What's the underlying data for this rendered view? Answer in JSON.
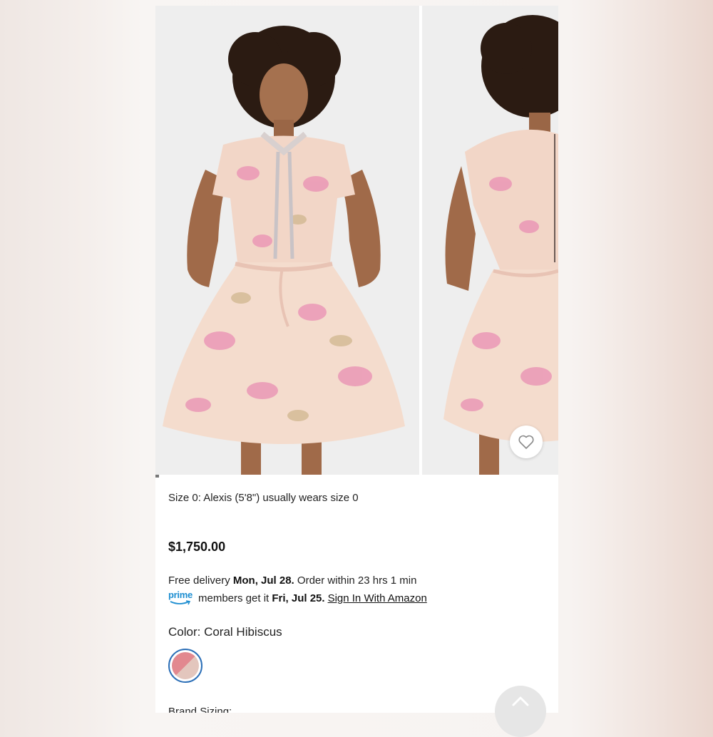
{
  "product": {
    "size_note": "Size 0: Alexis (5'8\") usually wears size 0",
    "price": "$1,750.00",
    "delivery": {
      "prefix": "Free delivery",
      "date": "Mon, Jul 28.",
      "suffix": "Order within 23 hrs 1 min"
    },
    "prime": {
      "logo_text": "prime",
      "prefix": "members get it",
      "date": "Fri, Jul 25.",
      "link": "Sign In With Amazon"
    },
    "color": {
      "label": "Color: Coral Hibiscus",
      "swatch_colors": [
        "#e2888f",
        "#e3c6bd"
      ],
      "selected_border": "#2c6fb7"
    },
    "brand_sizing_label": "Brand Sizing:"
  },
  "icons": {
    "favorite": "heart-outline-icon",
    "scroll_top": "chevron-up-icon",
    "prime_smile": "smile-arrow-icon"
  },
  "colors": {
    "dress_base": "#f2d6c7",
    "print_pink": "#e98fb3",
    "prime_blue": "#1d8ed1",
    "photo_background": "#eeeeee"
  }
}
